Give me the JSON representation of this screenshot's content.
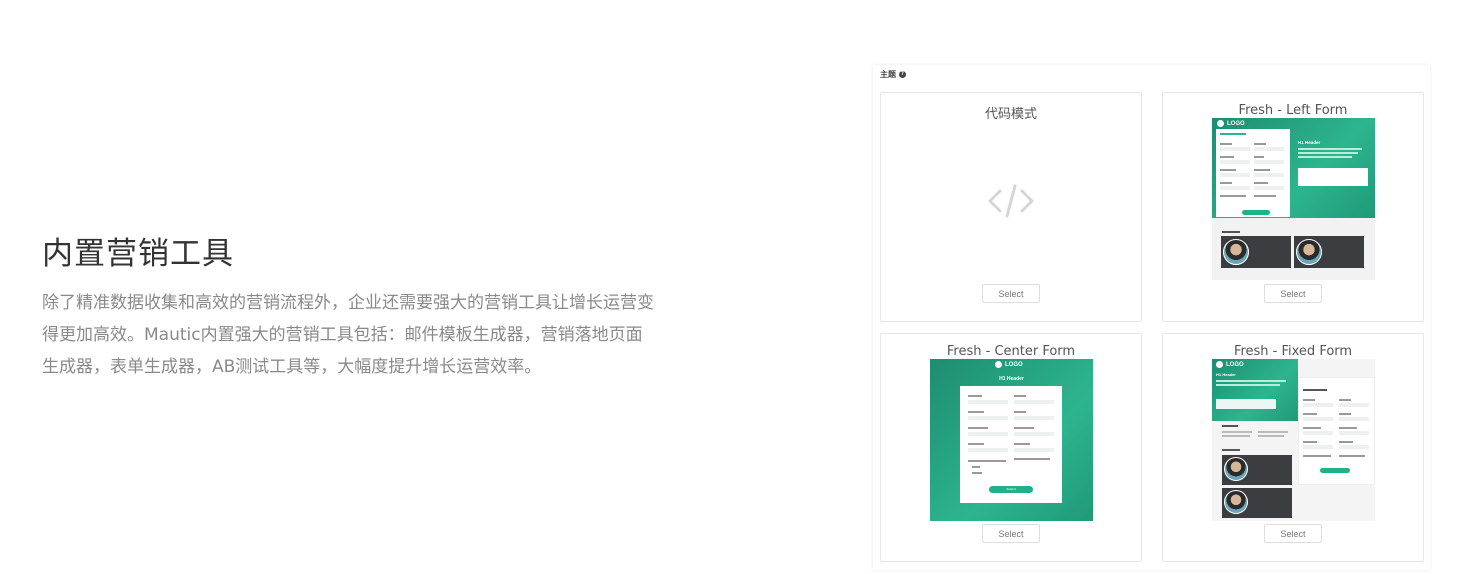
{
  "feature": {
    "title": "内置营销工具",
    "description_lines": [
      "除了精准数据收集和高效的营销流程外，企业还需要强大的营销工具让增长运营变",
      "得更加高效。Mautic内置强大的营销工具包括：邮件模板生成器，营销落地页面",
      "生成器，表单生成器，AB测试工具等，大幅度提升增长运营效率。"
    ]
  },
  "theme_panel": {
    "label": "主题",
    "help_icon": "question-circle-icon",
    "cards": [
      {
        "title": "代码模式",
        "select_label": "Select",
        "thumbnail": "code-icon"
      },
      {
        "title": "Fresh - Left Form",
        "select_label": "Select",
        "thumbnail": "fresh-left-form"
      },
      {
        "title": "Fresh - Center Form",
        "select_label": "Select",
        "thumbnail": "fresh-center-form"
      },
      {
        "title": "Fresh - Fixed Form",
        "select_label": "Select",
        "thumbnail": "fresh-fixed-form"
      }
    ],
    "thumb_text": {
      "logo": "LOGO",
      "h1": "H1 Header",
      "submit": "Submit"
    }
  },
  "colors": {
    "accent_green": "#2db58e",
    "dark_card": "#3b3d40",
    "text_muted": "#8a8a8a"
  }
}
